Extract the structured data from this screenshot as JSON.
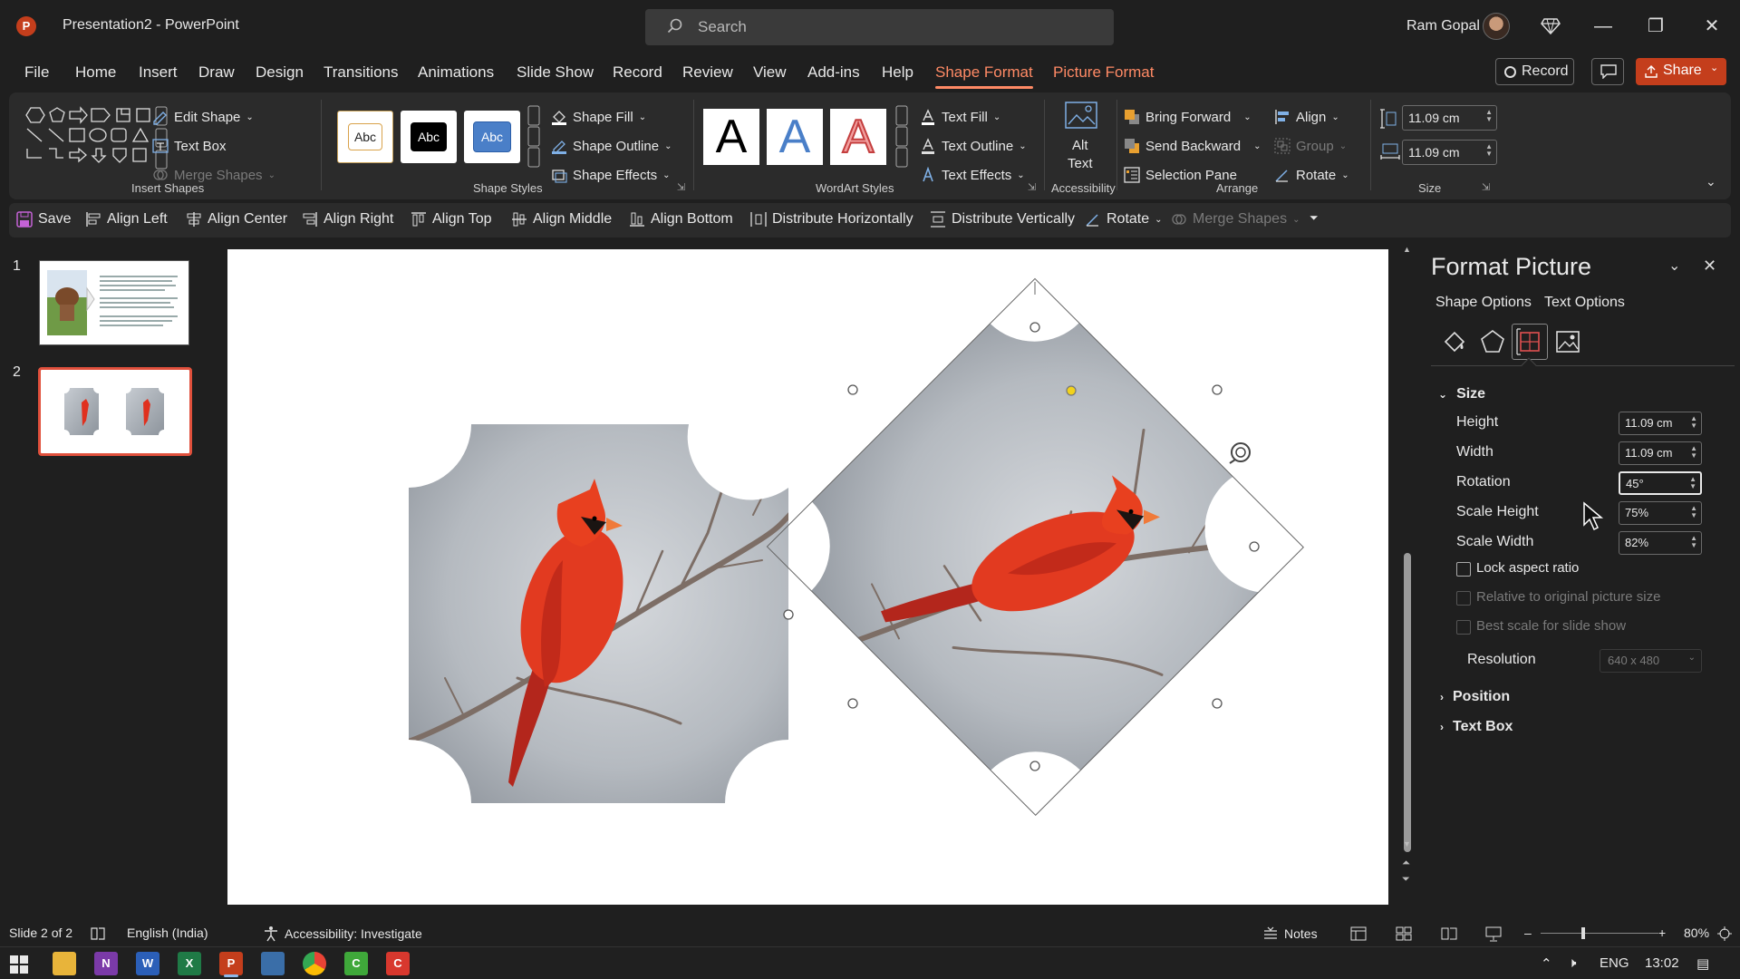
{
  "app": {
    "logo_letter": "P",
    "title": "Presentation2  -  PowerPoint",
    "search_placeholder": "Search",
    "user_name": "Ram Gopal",
    "window_controls": [
      "minimize",
      "restore",
      "close"
    ]
  },
  "menu": {
    "tabs": [
      "File",
      "Home",
      "Insert",
      "Draw",
      "Design",
      "Transitions",
      "Animations",
      "Slide Show",
      "Record",
      "Review",
      "View",
      "Add-ins",
      "Help",
      "Shape Format",
      "Picture Format"
    ],
    "active_tab": "Shape Format",
    "record_label": "Record",
    "share_label": "Share"
  },
  "ribbon": {
    "insert_shapes": {
      "label": "Insert Shapes",
      "edit_shape": "Edit Shape",
      "text_box": "Text Box",
      "merge_shapes": "Merge Shapes"
    },
    "shape_styles": {
      "label": "Shape Styles",
      "presets": [
        "Abc",
        "Abc",
        "Abc"
      ],
      "shape_fill": "Shape Fill",
      "shape_outline": "Shape Outline",
      "shape_effects": "Shape Effects"
    },
    "wordart_styles": {
      "label": "WordArt Styles",
      "letters": [
        "A",
        "A",
        "A"
      ],
      "text_fill": "Text Fill",
      "text_outline": "Text Outline",
      "text_effects": "Text Effects"
    },
    "accessibility": {
      "label": "Accessibility",
      "alt_text_line1": "Alt",
      "alt_text_line2": "Text"
    },
    "arrange": {
      "label": "Arrange",
      "bring_forward": "Bring Forward",
      "send_backward": "Send Backward",
      "selection_pane": "Selection Pane",
      "align": "Align",
      "group": "Group",
      "rotate": "Rotate"
    },
    "size": {
      "label": "Size",
      "height": "11.09 cm",
      "width": "11.09 cm"
    }
  },
  "quick_toolbar": {
    "items": [
      "Save",
      "Align Left",
      "Align Center",
      "Align Right",
      "Align Top",
      "Align Middle",
      "Align Bottom",
      "Distribute Horizontally",
      "Distribute Vertically",
      "Rotate",
      "Merge Shapes"
    ]
  },
  "slides": {
    "numbers": [
      "1",
      "2"
    ],
    "selected": 2
  },
  "format_pane": {
    "title": "Format Picture",
    "tabs": [
      "Shape Options",
      "Text Options"
    ],
    "icons": [
      "fill-line-icon",
      "effects-pentagon-icon",
      "size-properties-icon",
      "picture-icon"
    ],
    "size_section": "Size",
    "fields": [
      {
        "label": "Height",
        "value": "11.09 cm"
      },
      {
        "label": "Width",
        "value": "11.09 cm"
      },
      {
        "label": "Rotation",
        "value": "45°"
      },
      {
        "label": "Scale Height",
        "value": "75%"
      },
      {
        "label": "Scale Width",
        "value": "82%"
      }
    ],
    "lock_aspect_ratio": "Lock aspect ratio",
    "relative_original": "Relative to original picture size",
    "best_scale": "Best scale for slide show",
    "resolution_label": "Resolution",
    "resolution_value": "640 x 480",
    "position_section": "Position",
    "textbox_section": "Text Box"
  },
  "status": {
    "slide_info": "Slide 2 of 2",
    "language": "English (India)",
    "accessibility": "Accessibility: Investigate",
    "notes": "Notes",
    "zoom": "80%"
  },
  "taskbar": {
    "lang": "ENG",
    "time": "13:02"
  },
  "colors": {
    "accent": "#ff8a65",
    "share": "#c43e1c",
    "selection_handle_yellow": "#f2d21b"
  }
}
